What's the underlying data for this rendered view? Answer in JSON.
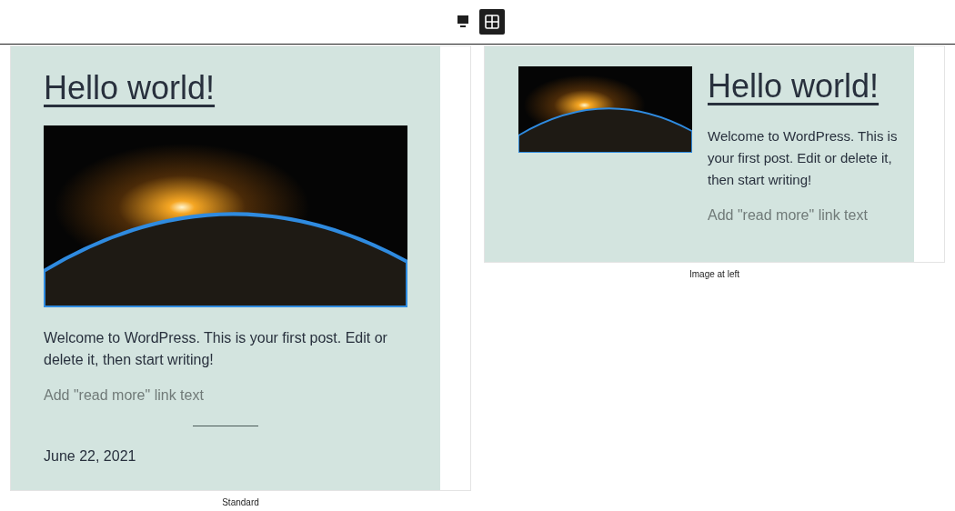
{
  "toolbar": {
    "views": [
      {
        "kind": "desktop",
        "selected": false
      },
      {
        "kind": "grid",
        "selected": true
      }
    ]
  },
  "patterns": [
    {
      "kind": "standard",
      "title": "Hello world!",
      "excerpt": "Welcome to WordPress. This is your first post. Edit or delete it, then start writing!",
      "read_more": {
        "placeholder": "Add \"read more\" link text"
      },
      "date": "June 22, 2021",
      "caption": "Standard"
    },
    {
      "kind": "image-left",
      "title": "Hello world!",
      "excerpt": "Welcome to WordPress. This is your first post. Edit or delete it, then start writing!",
      "read_more": {
        "placeholder": "Add \"read more\" link text"
      },
      "caption": "Image at left"
    }
  ]
}
